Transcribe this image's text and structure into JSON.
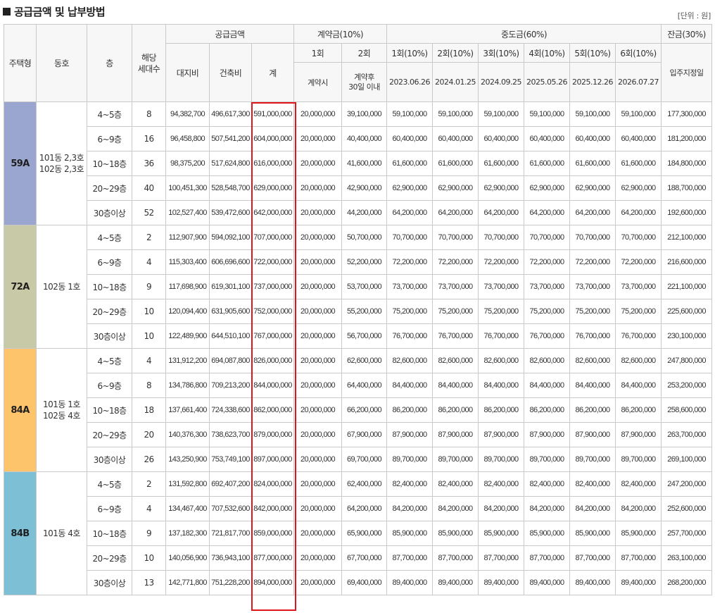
{
  "title": "공급금액 및 납부방법",
  "unit": "[단위 : 원]",
  "header": {
    "house_type": "주택형",
    "dong": "동호",
    "floor": "층",
    "households": "해당\n세대수",
    "supply_group": "공급금액",
    "land": "대지비",
    "building": "건축비",
    "total": "계",
    "contract_group": "계약금(10%)",
    "c1": "1회",
    "c2": "2회",
    "c1_when": "계약시",
    "c2_when": "계약후\n30일 이내",
    "middle_group": "중도금(60%)",
    "middle": [
      {
        "label": "1회(10%)",
        "date": "2023.06.26"
      },
      {
        "label": "2회(10%)",
        "date": "2024.01.25"
      },
      {
        "label": "3회(10%)",
        "date": "2024.09.25"
      },
      {
        "label": "4회(10%)",
        "date": "2025.05.26"
      },
      {
        "label": "5회(10%)",
        "date": "2025.12.26"
      },
      {
        "label": "6회(10%)",
        "date": "2026.07.27"
      }
    ],
    "balance_group": "잔금(30%)",
    "balance_when": "입주지정일"
  },
  "colors": {
    "59A": "#9aa6cf",
    "72A": "#c8c9a6",
    "84A": "#fdc46b",
    "84B": "#7dc0d5",
    "highlight": "#e0141b"
  },
  "groups": [
    {
      "type": "59A",
      "dong": "101동 2,3호\n102동 2,3호",
      "rows": [
        {
          "floor": "4~5층",
          "units": "8",
          "land": "94,382,700",
          "building": "496,617,300",
          "total": "591,000,000",
          "c1": "20,000,000",
          "c2": "39,100,000",
          "mid": "59,100,000",
          "bal": "177,300,000"
        },
        {
          "floor": "6~9층",
          "units": "16",
          "land": "96,458,800",
          "building": "507,541,200",
          "total": "604,000,000",
          "c1": "20,000,000",
          "c2": "40,400,000",
          "mid": "60,400,000",
          "bal": "181,200,000"
        },
        {
          "floor": "10~18층",
          "units": "36",
          "land": "98,375,200",
          "building": "517,624,800",
          "total": "616,000,000",
          "c1": "20,000,000",
          "c2": "41,600,000",
          "mid": "61,600,000",
          "bal": "184,800,000"
        },
        {
          "floor": "20~29층",
          "units": "40",
          "land": "100,451,300",
          "building": "528,548,700",
          "total": "629,000,000",
          "c1": "20,000,000",
          "c2": "42,900,000",
          "mid": "62,900,000",
          "bal": "188,700,000"
        },
        {
          "floor": "30층이상",
          "units": "52",
          "land": "102,527,400",
          "building": "539,472,600",
          "total": "642,000,000",
          "c1": "20,000,000",
          "c2": "44,200,000",
          "mid": "64,200,000",
          "bal": "192,600,000"
        }
      ]
    },
    {
      "type": "72A",
      "dong": "102동 1호",
      "rows": [
        {
          "floor": "4~5층",
          "units": "2",
          "land": "112,907,900",
          "building": "594,092,100",
          "total": "707,000,000",
          "c1": "20,000,000",
          "c2": "50,700,000",
          "mid": "70,700,000",
          "bal": "212,100,000"
        },
        {
          "floor": "6~9층",
          "units": "4",
          "land": "115,303,400",
          "building": "606,696,600",
          "total": "722,000,000",
          "c1": "20,000,000",
          "c2": "52,200,000",
          "mid": "72,200,000",
          "bal": "216,600,000"
        },
        {
          "floor": "10~18층",
          "units": "9",
          "land": "117,698,900",
          "building": "619,301,100",
          "total": "737,000,000",
          "c1": "20,000,000",
          "c2": "53,700,000",
          "mid": "73,700,000",
          "bal": "221,100,000"
        },
        {
          "floor": "20~29층",
          "units": "10",
          "land": "120,094,400",
          "building": "631,905,600",
          "total": "752,000,000",
          "c1": "20,000,000",
          "c2": "55,200,000",
          "mid": "75,200,000",
          "bal": "225,600,000"
        },
        {
          "floor": "30층이상",
          "units": "10",
          "land": "122,489,900",
          "building": "644,510,100",
          "total": "767,000,000",
          "c1": "20,000,000",
          "c2": "56,700,000",
          "mid": "76,700,000",
          "bal": "230,100,000"
        }
      ]
    },
    {
      "type": "84A",
      "dong": "101동 1호\n102동 4호",
      "rows": [
        {
          "floor": "4~5층",
          "units": "4",
          "land": "131,912,200",
          "building": "694,087,800",
          "total": "826,000,000",
          "c1": "20,000,000",
          "c2": "62,600,000",
          "mid": "82,600,000",
          "bal": "247,800,000"
        },
        {
          "floor": "6~9층",
          "units": "8",
          "land": "134,786,800",
          "building": "709,213,200",
          "total": "844,000,000",
          "c1": "20,000,000",
          "c2": "64,400,000",
          "mid": "84,400,000",
          "bal": "253,200,000"
        },
        {
          "floor": "10~18층",
          "units": "18",
          "land": "137,661,400",
          "building": "724,338,600",
          "total": "862,000,000",
          "c1": "20,000,000",
          "c2": "66,200,000",
          "mid": "86,200,000",
          "bal": "258,600,000"
        },
        {
          "floor": "20~29층",
          "units": "20",
          "land": "140,376,300",
          "building": "738,623,700",
          "total": "879,000,000",
          "c1": "20,000,000",
          "c2": "67,900,000",
          "mid": "87,900,000",
          "bal": "263,700,000"
        },
        {
          "floor": "30층이상",
          "units": "26",
          "land": "143,250,900",
          "building": "753,749,100",
          "total": "897,000,000",
          "c1": "20,000,000",
          "c2": "69,700,000",
          "mid": "89,700,000",
          "bal": "269,100,000"
        }
      ]
    },
    {
      "type": "84B",
      "dong": "101동 4호",
      "rows": [
        {
          "floor": "4~5층",
          "units": "2",
          "land": "131,592,800",
          "building": "692,407,200",
          "total": "824,000,000",
          "c1": "20,000,000",
          "c2": "62,400,000",
          "mid": "82,400,000",
          "bal": "247,200,000"
        },
        {
          "floor": "6~9층",
          "units": "4",
          "land": "134,467,400",
          "building": "707,532,600",
          "total": "842,000,000",
          "c1": "20,000,000",
          "c2": "64,200,000",
          "mid": "84,200,000",
          "bal": "252,600,000"
        },
        {
          "floor": "10~18층",
          "units": "9",
          "land": "137,182,300",
          "building": "721,817,700",
          "total": "859,000,000",
          "c1": "20,000,000",
          "c2": "65,900,000",
          "mid": "85,900,000",
          "bal": "257,700,000"
        },
        {
          "floor": "20~29층",
          "units": "10",
          "land": "140,056,900",
          "building": "736,943,100",
          "total": "877,000,000",
          "c1": "20,000,000",
          "c2": "67,700,000",
          "mid": "87,700,000",
          "bal": "263,100,000"
        },
        {
          "floor": "30층이상",
          "units": "13",
          "land": "142,771,800",
          "building": "751,228,200",
          "total": "894,000,000",
          "c1": "20,000,000",
          "c2": "69,400,000",
          "mid": "89,400,000",
          "bal": "268,200,000"
        }
      ]
    }
  ]
}
